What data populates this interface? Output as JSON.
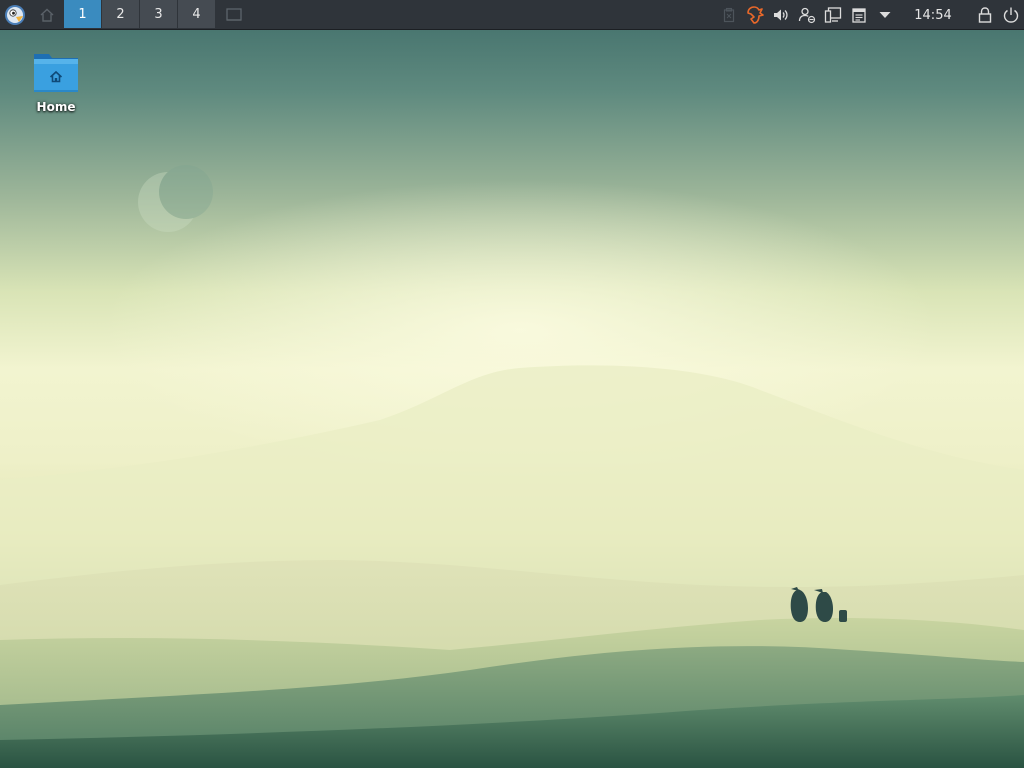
{
  "taskbar": {
    "workspaces": [
      {
        "label": "1",
        "active": true
      },
      {
        "label": "2",
        "active": false
      },
      {
        "label": "3",
        "active": false
      },
      {
        "label": "4",
        "active": false
      }
    ],
    "clock": "14:54",
    "tray_icons": [
      "clipboard-trash-icon",
      "update-manager-icon",
      "volume-icon",
      "user-switch-icon",
      "network-icon",
      "notes-icon",
      "dropdown-arrow-icon"
    ],
    "accent_color": "#3a8bbf"
  },
  "desktop": {
    "icons": [
      {
        "label": "Home",
        "icon": "home-folder-icon"
      }
    ]
  }
}
